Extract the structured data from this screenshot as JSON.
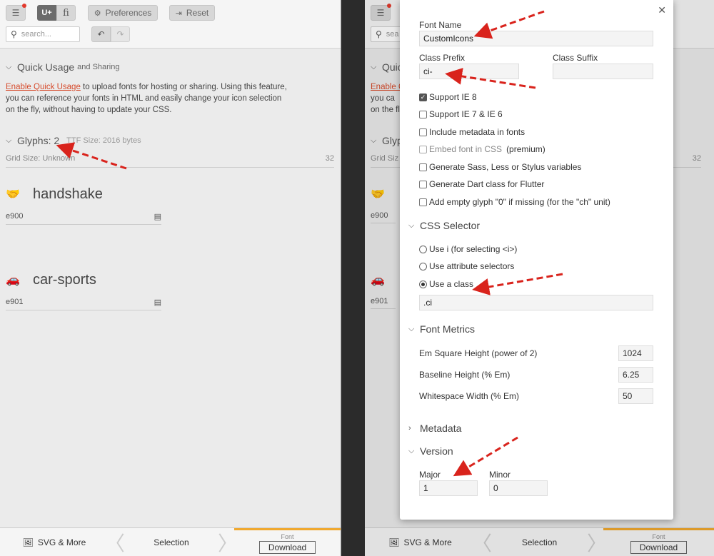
{
  "toolbar": {
    "preferences_label": "Preferences",
    "reset_label": "Reset",
    "u_plus_label": "U+",
    "fi_label": "fi",
    "search_placeholder": "search..."
  },
  "quick_usage": {
    "title": "Quick Usage",
    "title_suffix": "and Sharing",
    "link_text": "Enable Quick Usage",
    "text": " to upload fonts for hosting or sharing. Using this feature, you can reference your fonts in HTML and easily change your icon selection on the fly, without having to update your CSS."
  },
  "glyphs": {
    "title": "Glyphs: 2",
    "ttf_size": "TTF Size: 2016 bytes",
    "grid_size": "Grid Size: Unknown",
    "grid_value": "32",
    "items": [
      {
        "name": "handshake",
        "code": "e900",
        "icon": "handshake-icon"
      },
      {
        "name": "car-sports",
        "code": "e901",
        "icon": "car-icon"
      }
    ]
  },
  "right_bg": {
    "search_placeholder": "sea",
    "quick_usage_title": "Quic",
    "link_text": "Enable Q",
    "text_line2": "you ca",
    "text_line3": "on the fl",
    "glyphs_title": "Glyp",
    "grid_size": "Grid Siz",
    "grid_value": "32"
  },
  "bottombar": {
    "svg_label": "SVG & More",
    "selection_label": "Selection",
    "font_label": "Font",
    "download_label": "Download"
  },
  "modal": {
    "font_name_label": "Font Name",
    "font_name_value": "CustomIcons",
    "class_prefix_label": "Class Prefix",
    "class_prefix_value": "ci-",
    "class_suffix_label": "Class Suffix",
    "class_suffix_value": "",
    "options": [
      {
        "label": "Support IE 8",
        "checked": true,
        "disabled": false
      },
      {
        "label": "Support IE 7 & IE 6",
        "checked": false,
        "disabled": false
      },
      {
        "label": "Include metadata in fonts",
        "checked": false,
        "disabled": false
      },
      {
        "label": "Embed font in CSS",
        "extra": "(premium)",
        "checked": false,
        "disabled": true
      },
      {
        "label": "Generate Sass, Less or Stylus variables",
        "checked": false,
        "disabled": false
      },
      {
        "label": "Generate Dart class for Flutter",
        "checked": false,
        "disabled": false
      },
      {
        "label": "Add empty glyph \"0\" if missing (for the \"ch\" unit)",
        "checked": false,
        "disabled": false
      }
    ],
    "css_selector_title": "CSS Selector",
    "selectors": [
      {
        "label": "Use i (for selecting <i>)",
        "checked": false
      },
      {
        "label": "Use attribute selectors",
        "checked": false
      },
      {
        "label": "Use a class",
        "checked": true
      }
    ],
    "class_value": ".ci",
    "font_metrics_title": "Font Metrics",
    "metrics": [
      {
        "label": "Em Square Height (power of 2)",
        "value": "1024"
      },
      {
        "label": "Baseline Height (% Em)",
        "value": "6.25"
      },
      {
        "label": "Whitespace Width (% Em)",
        "value": "50"
      }
    ],
    "metadata_title": "Metadata",
    "version_title": "Version",
    "major_label": "Major",
    "major_value": "1",
    "minor_label": "Minor",
    "minor_value": "0"
  },
  "colors": {
    "accent": "#d64b2c",
    "annotation_arrow": "#d9231c",
    "font_tab": "#f0a82d"
  }
}
